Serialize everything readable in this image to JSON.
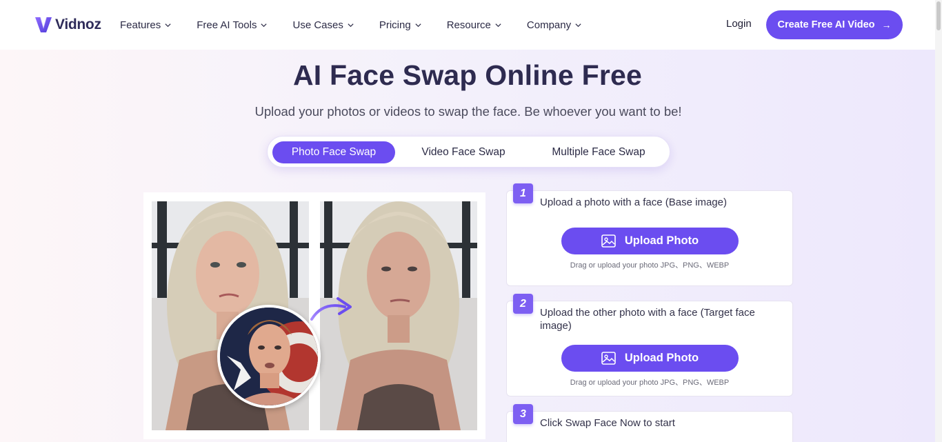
{
  "header": {
    "logo_text": "Vidnoz",
    "nav": [
      {
        "label": "Features",
        "icon": "chevron-down-icon"
      },
      {
        "label": "Free AI Tools",
        "icon": "chevron-down-icon"
      },
      {
        "label": "Use Cases",
        "icon": "chevron-down-icon"
      },
      {
        "label": "Pricing",
        "icon": "chevron-down-icon"
      },
      {
        "label": "Resource",
        "icon": "chevron-down-icon"
      },
      {
        "label": "Company",
        "icon": "chevron-down-icon"
      }
    ],
    "login_label": "Login",
    "cta_label": "Create Free AI Video",
    "cta_icon": "arrow-right-icon"
  },
  "hero": {
    "title": "AI Face Swap Online Free",
    "subtitle": "Upload your photos or videos to swap the face. Be whoever you want to be!",
    "tabs": [
      {
        "label": "Photo Face Swap",
        "active": true
      },
      {
        "label": "Video Face Swap",
        "active": false
      },
      {
        "label": "Multiple Face Swap",
        "active": false
      }
    ]
  },
  "demo": {
    "before_image": "base-photo",
    "after_image": "swapped-photo",
    "face_image": "target-face-avatar",
    "arrow_icon": "curved-arrow-icon"
  },
  "steps": [
    {
      "number": "1",
      "text": "Upload a photo with a face (Base image)",
      "button": "Upload Photo",
      "hint": "Drag or upload your photo JPG、PNG、WEBP"
    },
    {
      "number": "2",
      "text": "Upload the other photo with a face (Target face image)",
      "button": "Upload Photo",
      "hint": "Drag or upload your photo JPG、PNG、WEBP"
    },
    {
      "number": "3",
      "text": "Click Swap Face Now to start"
    }
  ],
  "colors": {
    "accent": "#6b4df0",
    "title": "#2e2b50",
    "badge": "#7d5ff2"
  }
}
